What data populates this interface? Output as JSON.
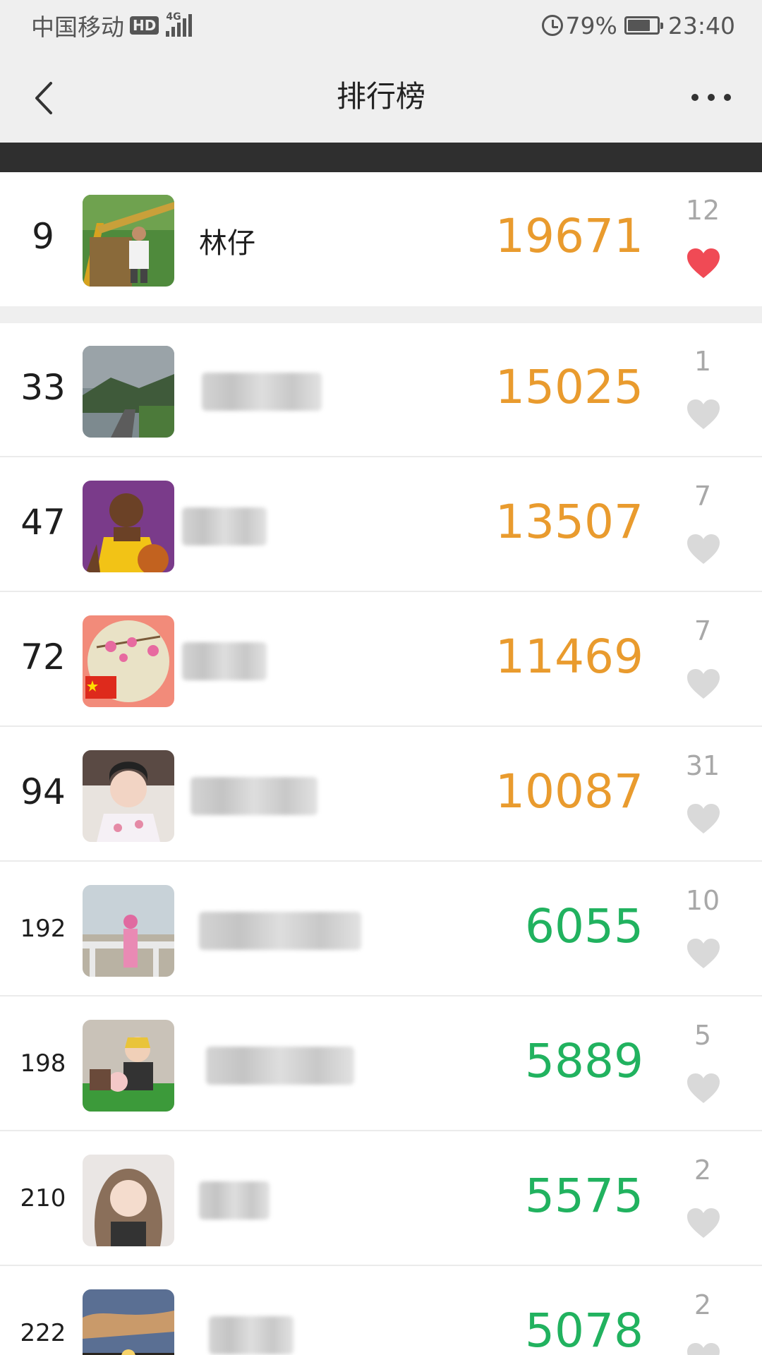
{
  "status_bar": {
    "carrier": "中国移动",
    "hd_badge": "HD",
    "network": "4G",
    "battery_percent": "79%",
    "battery_level": 0.79,
    "time": "23:40"
  },
  "nav": {
    "title": "排行榜",
    "back_icon": "chevron-left-icon",
    "more_icon": "more-dots-icon"
  },
  "colors": {
    "steps_high": "#e99b2e",
    "steps_low": "#21b25f",
    "heart_liked": "#f04a55",
    "heart_default": "#d9d9d9"
  },
  "my_rank": {
    "rank": "9",
    "name": "林仔",
    "steps": "19671",
    "likes": "12",
    "liked": true
  },
  "rankings": [
    {
      "rank": "33",
      "name": "",
      "steps": "15025",
      "likes": "1",
      "liked": false
    },
    {
      "rank": "47",
      "name": "",
      "steps": "13507",
      "likes": "7",
      "liked": false
    },
    {
      "rank": "72",
      "name": "",
      "steps": "11469",
      "likes": "7",
      "liked": false
    },
    {
      "rank": "94",
      "name": "",
      "steps": "10087",
      "likes": "31",
      "liked": false
    },
    {
      "rank": "192",
      "name": "",
      "steps": "6055",
      "likes": "10",
      "liked": false
    },
    {
      "rank": "198",
      "name": "",
      "steps": "5889",
      "likes": "5",
      "liked": false
    },
    {
      "rank": "210",
      "name": "",
      "steps": "5575",
      "likes": "2",
      "liked": false
    },
    {
      "rank": "222",
      "name": "",
      "steps": "5078",
      "likes": "2",
      "liked": false
    }
  ]
}
